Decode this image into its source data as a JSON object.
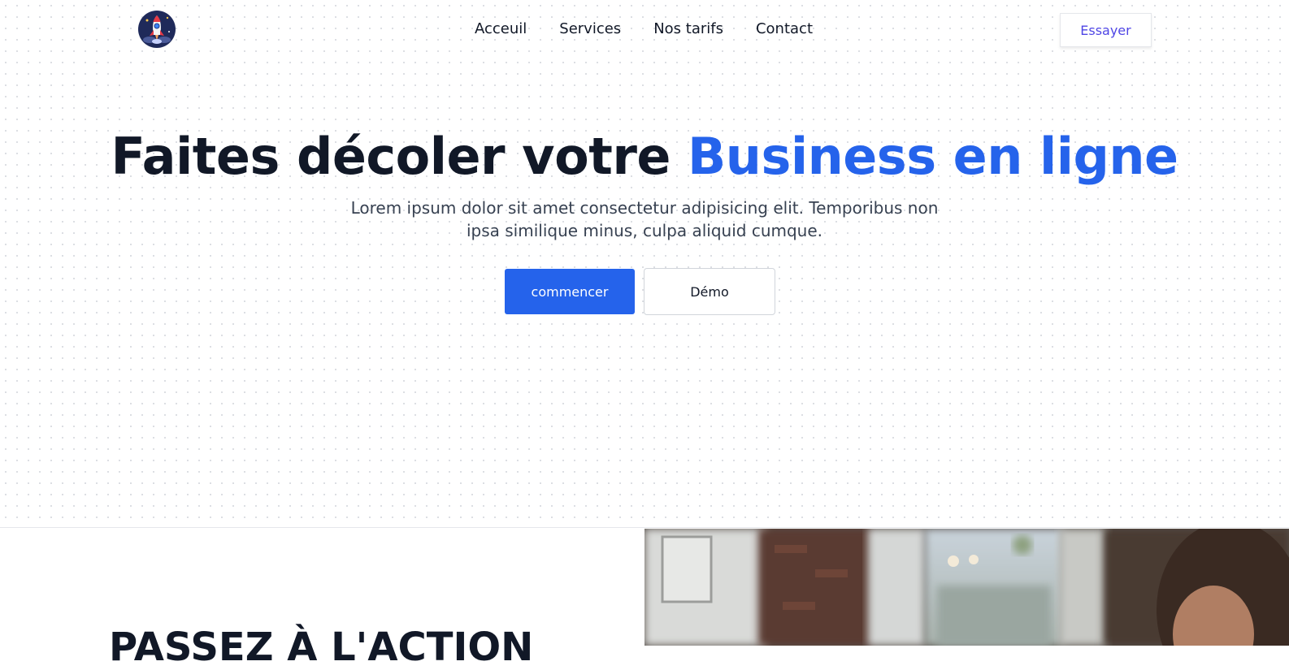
{
  "nav": {
    "links": [
      "Acceuil",
      "Services",
      "Nos tarifs",
      "Contact"
    ],
    "cta": "Essayer"
  },
  "hero": {
    "title_part1": "Faites décoler votre ",
    "title_accent": "Business en ligne",
    "subtitle": "Lorem ipsum dolor sit amet consectetur adipisicing elit. Temporibus non ipsa similique minus, culpa aliquid cumque.",
    "primary_button": "commencer",
    "secondary_button": "Démo"
  },
  "section2": {
    "title": "PASSEZ À L'ACTION"
  },
  "colors": {
    "accent": "#2563eb",
    "cta_text": "#4f46e5",
    "heading": "#111827"
  },
  "icons": {
    "logo": "rocket-logo-icon"
  }
}
